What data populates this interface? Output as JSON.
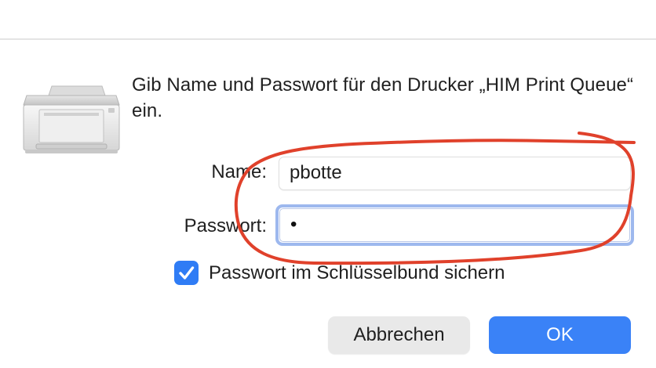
{
  "dialog": {
    "message": "Gib Name und Passwort für den Drucker „HIM Print Queue“ ein.",
    "icon": "printer-icon"
  },
  "form": {
    "name_label": "Name:",
    "name_value": "pbotte",
    "password_label": "Passwort:",
    "password_value": "•",
    "keychain_label": "Passwort im Schlüsselbund sichern",
    "keychain_checked": true
  },
  "buttons": {
    "cancel": "Abbrechen",
    "ok": "OK"
  },
  "colors": {
    "accent": "#3a82f7",
    "focus_ring": "#9db8ee",
    "annotation": "#e0412b"
  }
}
